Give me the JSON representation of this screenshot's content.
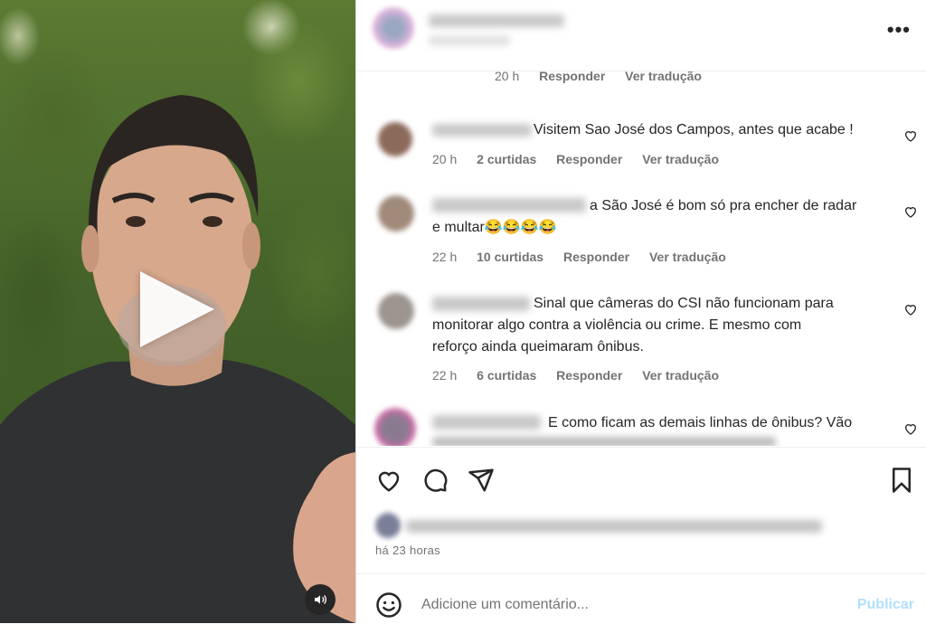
{
  "post": {
    "header": {
      "more_icon": "more-horizontal-icon",
      "more_label": "•••"
    },
    "comments": [
      {
        "time": "20 h",
        "reply": "Responder",
        "translate": "Ver tradução"
      },
      {
        "text": "Visitem Sao José dos Campos, antes que acabe !",
        "time": "20 h",
        "likes": "2 curtidas",
        "reply": "Responder",
        "translate": "Ver tradução"
      },
      {
        "text_line1": "a São José é bom só pra encher de radar",
        "text_line2": "e multar😂😂😂😂",
        "time": "22 h",
        "likes": "10 curtidas",
        "reply": "Responder",
        "translate": "Ver tradução"
      },
      {
        "text_line1": "Sinal que câmeras do CSI não funcionam para",
        "text_line2": "monitorar algo contra a violência ou crime. E mesmo com",
        "text_line3": "reforço ainda queimaram ônibus.",
        "time": "22 h",
        "likes": "6 curtidas",
        "reply": "Responder",
        "translate": "Ver tradução"
      },
      {
        "text_line1": "E como ficam as demais linhas de ônibus? Vão"
      }
    ],
    "actions": {
      "like_icon": "heart-icon",
      "comment_icon": "comment-icon",
      "share_icon": "send-icon",
      "save_icon": "bookmark-icon"
    },
    "posted_time": "há 23 horas",
    "add_comment": {
      "placeholder": "Adicione um comentário...",
      "publish": "Publicar",
      "emoji_icon": "emoji-icon"
    }
  },
  "video": {
    "play_icon": "play-icon",
    "sound_icon": "speaker-icon"
  },
  "colors": {
    "link_disabled": "#b2dffc",
    "secondary_text": "#737373",
    "primary_text": "#262626"
  }
}
